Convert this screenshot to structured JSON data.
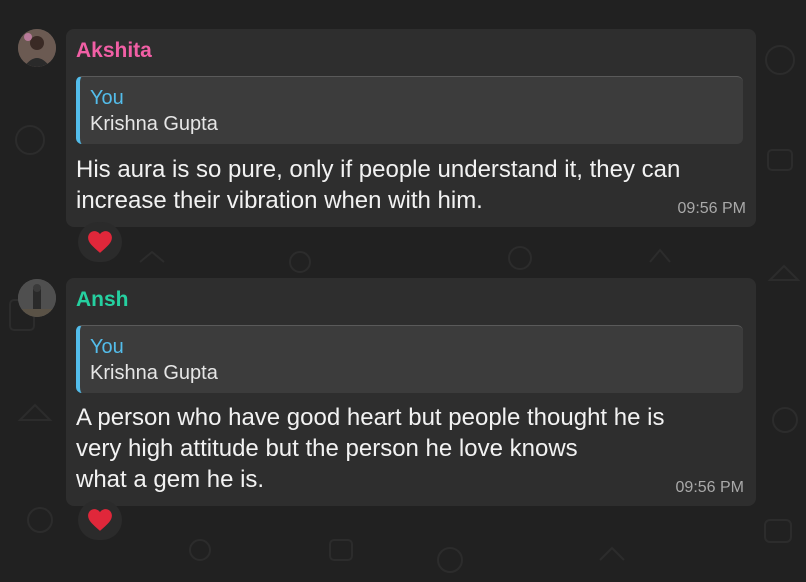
{
  "messages": [
    {
      "sender": "Akshita",
      "sender_color": "#f15fa5",
      "quote_author": "You",
      "quote_text": "Krishna Gupta",
      "text": "His aura is so pure, only if people understand it, they can\nincrease their vibration when with him.",
      "time": "09:56 PM",
      "reaction": "heart-icon"
    },
    {
      "sender": "Ansh",
      "sender_color": "#25d0a0",
      "quote_author": "You",
      "quote_text": "Krishna Gupta",
      "text": "A person who have good heart but people thought he is\nvery high attitude but the person he love knows\nwhat a gem he is.",
      "time": "09:56 PM",
      "reaction": "heart-icon"
    }
  ],
  "colors": {
    "background": "#212121",
    "bubble": "#2e2e2e",
    "quote_bar": "#53bdeb",
    "reaction_heart": "#e0273a"
  }
}
